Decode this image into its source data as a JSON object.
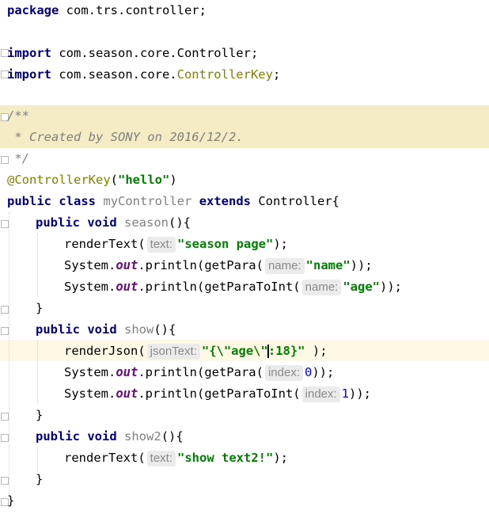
{
  "editor": {
    "lines": {
      "l1": {
        "kw": "package",
        "text": " com.trs.controller;"
      },
      "l3": {
        "kw": "import",
        "text": " com.season.core.Controller;"
      },
      "l4": {
        "kw": "import",
        "text": " com.season.core.",
        "unused": "ControllerKey",
        "end": ";"
      },
      "l6": {
        "text": "/**"
      },
      "l7": {
        "text": " * Created by SONY on 2016/12/2."
      },
      "l8": {
        "text": " */"
      },
      "l9": {
        "ann": "@ControllerKey",
        "open": "(",
        "str": "\"hello\"",
        "close": ")"
      },
      "l10": {
        "kw1": "public",
        "kw2": "class",
        "name": "myController",
        "kw3": "extends",
        "tail": " Controller{"
      },
      "l11": {
        "kw1": "public",
        "kw2": "void",
        "name": "season",
        "tail": "(){"
      },
      "l12": {
        "call": "renderText(",
        "hint": "text:",
        "str": "\"season page\"",
        "end": ");"
      },
      "l13": {
        "pre": "System.",
        "fld": "out",
        "mid": ".println(getPara(",
        "hint": "name:",
        "str": "\"name\"",
        "end": "));"
      },
      "l14": {
        "pre": "System.",
        "fld": "out",
        "mid": ".println(getParaToInt(",
        "hint": "name:",
        "str": "\"age\"",
        "end": "));"
      },
      "l15": {
        "text": "}"
      },
      "l16": {
        "kw1": "public",
        "kw2": "void",
        "name": "show",
        "tail": "(){"
      },
      "l17": {
        "call": "renderJson(",
        "hint": "jsonText:",
        "str1": "\"{\\\"age\\\"",
        "str2": ":18}\"",
        "end": ");"
      },
      "l18": {
        "pre": "System.",
        "fld": "out",
        "mid": ".println(getPara(",
        "hint": "index:",
        "num": "0",
        "end": "));"
      },
      "l19": {
        "pre": "System.",
        "fld": "out",
        "mid": ".println(getParaToInt(",
        "hint": "index:",
        "num": "1",
        "end": "));"
      },
      "l20": {
        "text": "}"
      },
      "l21": {
        "kw1": "public",
        "kw2": "void",
        "name": "show2",
        "tail": "(){"
      },
      "l22": {
        "call": "renderText(",
        "hint": "text:",
        "str": "\"show text2!\"",
        "end": ");"
      },
      "l23": {
        "text": "}"
      },
      "l24": {
        "text": "}"
      }
    }
  }
}
